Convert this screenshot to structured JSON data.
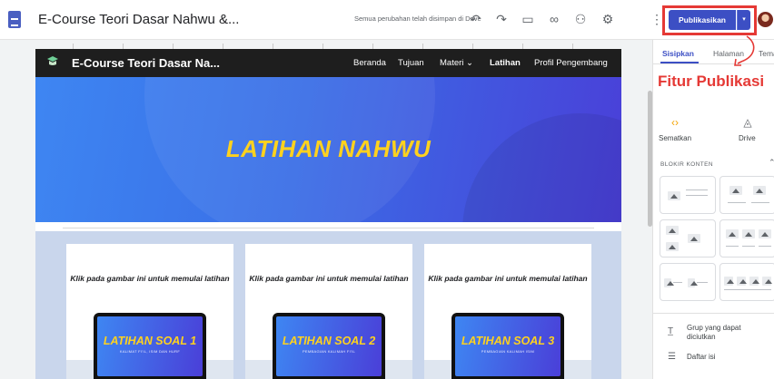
{
  "document": {
    "title": "E-Course Teori Dasar Nahwu &...",
    "save_status": "Semua perubahan telah disimpan di Drive"
  },
  "toolbar": {
    "icons": [
      "undo-icon",
      "redo-icon",
      "preview-icon",
      "link-icon",
      "share-icon",
      "settings-icon",
      "more-options-icon"
    ],
    "undo_glyph": "↶",
    "redo_glyph": "↷",
    "preview_glyph": "▭",
    "link_glyph": "∞",
    "share_glyph": "⚇",
    "settings_glyph": "⚙",
    "more_glyph": "⋮",
    "publish_label": "Publikasikan",
    "publish_dropdown_glyph": "▾"
  },
  "annotation": {
    "label": "Fitur Publikasi",
    "color": "#e53935"
  },
  "site": {
    "name": "E-Course Teori Dasar Na...",
    "nav": [
      "Beranda",
      "Tujuan",
      "Materi ⌄",
      "Latihan",
      "Profil Pengembang"
    ],
    "active_nav": "Latihan",
    "hero_title": "LATIHAN NAHWU",
    "cards": [
      {
        "caption": "Klik pada gambar ini untuk memulai latihan",
        "screen_title": "LATIHAN SOAL 1",
        "screen_sub": "KALIMAT FI'IL, ISIM DAN HURF"
      },
      {
        "caption": "Klik pada gambar ini untuk memulai latihan",
        "screen_title": "LATIHAN SOAL 2",
        "screen_sub": "PEMBAGIAN KALIMAH FI'IL"
      },
      {
        "caption": "Klik pada gambar ini untuk memulai latihan",
        "screen_title": "LATIHAN SOAL 3",
        "screen_sub": "PEMBAGIAN KALIMAH ISIM"
      }
    ]
  },
  "side_panel": {
    "tabs": [
      "Sisipkan",
      "Halaman",
      "Tema"
    ],
    "active_tab": "Sisipkan",
    "insert_items": [
      {
        "label": "Sematkan",
        "icon": "embed-icon",
        "glyph": "‹›"
      },
      {
        "label": "Drive",
        "icon": "drive-icon",
        "glyph": "◬"
      }
    ],
    "section_title": "BLOKIR KONTEN",
    "section_chevron": "⌃",
    "list_items": [
      {
        "label": "Grup yang dapat diciutkan",
        "icon": "collapsible-group-icon",
        "glyph": "T̲"
      },
      {
        "label": "Daftar isi",
        "icon": "table-of-contents-icon",
        "glyph": "☰"
      }
    ]
  },
  "colors": {
    "accent": "#3c4fc4",
    "hero_title": "#ffd21e",
    "highlight": "#e53935"
  }
}
